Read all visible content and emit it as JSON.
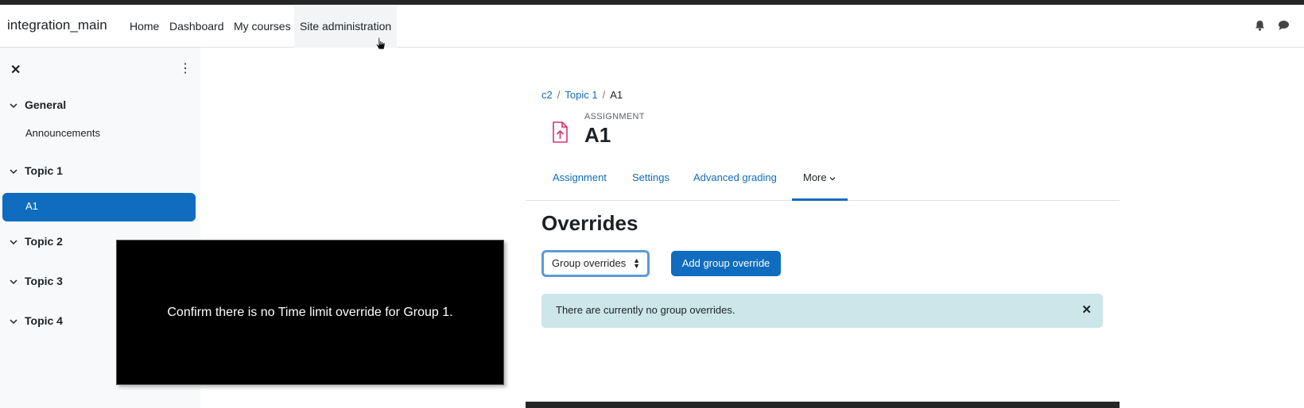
{
  "navbar": {
    "brand": "integration_main",
    "links": [
      "Home",
      "Dashboard",
      "My courses",
      "Site administration"
    ]
  },
  "drawer": {
    "sections": [
      {
        "label": "General",
        "items": [
          "Announcements"
        ]
      },
      {
        "label": "Topic 1",
        "items": [
          "A1"
        ]
      },
      {
        "label": "Topic 2",
        "items": []
      },
      {
        "label": "Topic 3",
        "items": []
      },
      {
        "label": "Topic 4",
        "items": []
      }
    ]
  },
  "breadcrumb": [
    "c2",
    "Topic 1",
    "A1"
  ],
  "activity": {
    "type": "ASSIGNMENT",
    "title": "A1",
    "icon": "file-upload-icon",
    "icon_color": "#d6336c"
  },
  "tabs": [
    "Assignment",
    "Settings",
    "Advanced grading",
    "More"
  ],
  "main": {
    "heading": "Overrides",
    "select_value": "Group overrides",
    "add_button": "Add group override",
    "alert": "There are currently no group overrides."
  },
  "overlay": {
    "caption": "Confirm there is no Time limit override for Group 1."
  },
  "colors": {
    "primary": "#0f6cbf",
    "alert_bg": "#cce6ea",
    "drawer_bg": "#f8f9fa"
  }
}
